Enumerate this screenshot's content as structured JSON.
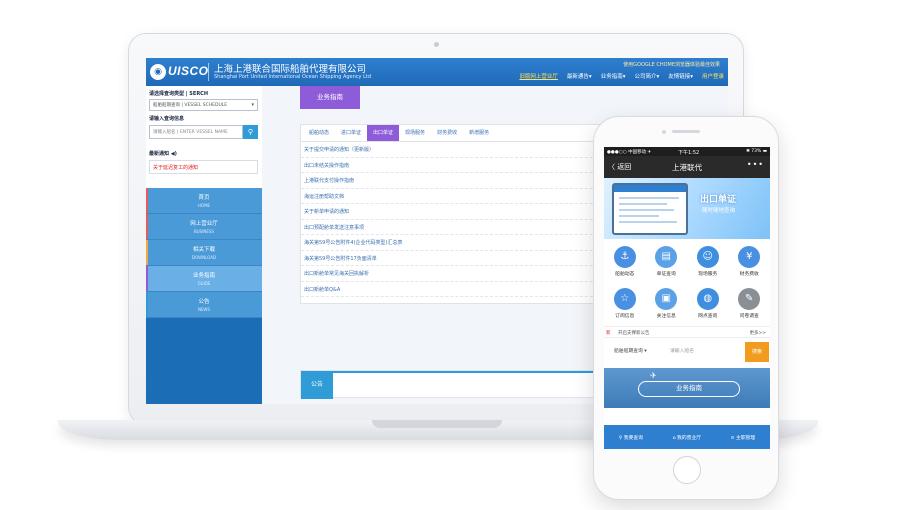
{
  "laptop": {
    "header": {
      "logo": "UISCO",
      "company_cn": "上海上港联合国际船舶代理有限公司",
      "company_en": "Shanghai Port United International Ocean Shipping Agency Ltd",
      "top_notice": "使用GOOGLE CHOME浏览器体验最佳效果",
      "nav": [
        "旧版网上营业厅",
        "最新通告▾",
        "业务指南▾",
        "公司简介▾",
        "友情链接▾",
        "用户登录"
      ]
    },
    "sidebar": {
      "query_label": "请选择查询类型 | SERCH",
      "query_select": "船舶船期查询 | VESSEL SCHEDULE",
      "input_label": "请输入查询信息",
      "input_placeholder": "请输入船名 | ENTER VESSEL NAME",
      "search_icon": "search-icon",
      "news_label": "最新通知 ◀)",
      "news_item": "关于延迟复工的通知",
      "menu": [
        {
          "cn": "首页",
          "en": "HOME",
          "bar": "#e85a5a"
        },
        {
          "cn": "网上营业厅",
          "en": "BUSINESS",
          "bar": "#e85a5a"
        },
        {
          "cn": "相关下载",
          "en": "DOWNLOAD",
          "bar": "#f2a93b"
        },
        {
          "cn": "业务指南",
          "en": "GUIDE",
          "bar": "#8e5cd9"
        },
        {
          "cn": "公告",
          "en": "NEWS",
          "bar": "#2f9bd7"
        }
      ]
    },
    "content": {
      "head": "业务指南",
      "tabs": [
        "船舶动态",
        "进口单证",
        "出口单证",
        "现场服务",
        "财务费收",
        "新增服务"
      ],
      "active_tab": "出口单证",
      "rows": [
        "关于提交申请的通知（更新版）",
        "出口未结关操作指南",
        "上港联代支付操作指南",
        "海运注册帮助文档",
        "关于新单申请的通知",
        "出口预配舱单发送注意事项",
        "海关第59号公告附件4(企业代码类型)汇总表",
        "海关第59号公告附件17负面清单",
        "出口新舱单常见海关回执解析",
        "出口新舱单Q&A"
      ],
      "notice_tab": "公告"
    }
  },
  "phone": {
    "status": {
      "left": "●●●○○ 中国移动 ✈",
      "time": "下午1:52",
      "right": "✱ 73% ▬"
    },
    "titlebar": {
      "back": "〈 返回",
      "title": "上港联代",
      "more": "•••"
    },
    "banner": {
      "title": "出口单证",
      "subtitle": "随时随地查询"
    },
    "grid": [
      {
        "label": "船舶动态",
        "icon": "ship-icon",
        "color": "#4a90e2"
      },
      {
        "label": "单证查询",
        "icon": "document-icon",
        "color": "#5aa1e8"
      },
      {
        "label": "现场服务",
        "icon": "person-icon",
        "color": "#3f8ee0"
      },
      {
        "label": "财务费收",
        "icon": "money-icon",
        "color": "#4a90e2"
      },
      {
        "label": "订阅信息",
        "icon": "star-icon",
        "color": "#4a90e2"
      },
      {
        "label": "关注信息",
        "icon": "monitor-icon",
        "color": "#5aa1e8"
      },
      {
        "label": "网点查询",
        "icon": "globe-icon",
        "color": "#3f8ee0"
      },
      {
        "label": "问卷调查",
        "icon": "chat-icon",
        "color": "#8a8f96"
      }
    ],
    "notice": {
      "tag": "新",
      "text": "开启支撑新公告",
      "more": "更多>>"
    },
    "query": {
      "select": "船舶船期查询 ▾",
      "placeholder": "请输入船名",
      "button": "搜索"
    },
    "guide": {
      "label": "业务指南"
    },
    "bottom": [
      "⚲ 我要查询",
      "⌂ 我的营业厅",
      "⊙ 主职管理"
    ]
  }
}
